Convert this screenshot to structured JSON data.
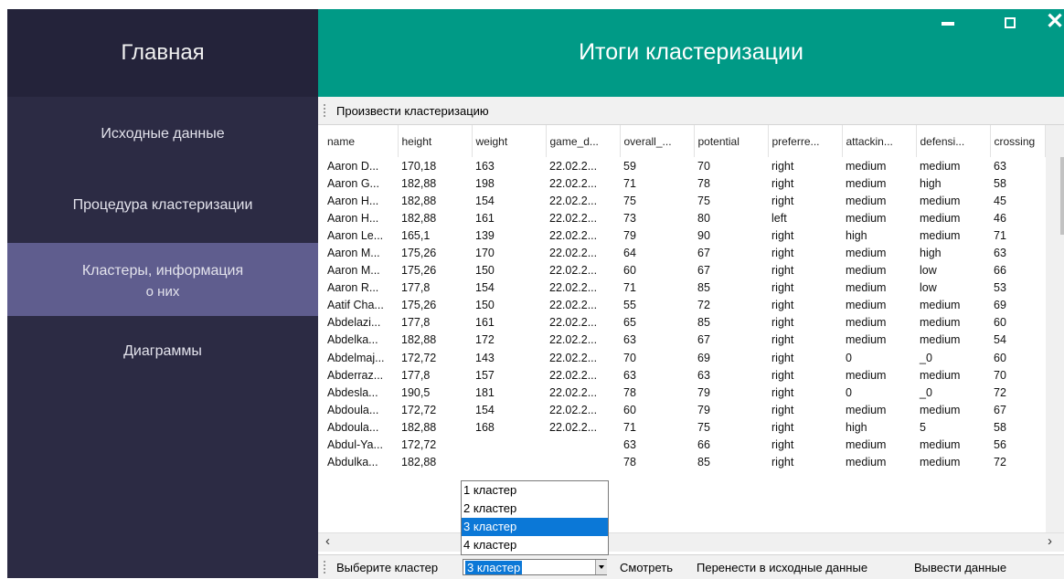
{
  "sidebar": {
    "title": "Главная",
    "items": [
      {
        "label": "Исходные данные"
      },
      {
        "label": "Процедура кластеризации"
      },
      {
        "label_line1": "Кластеры, информация",
        "label_line2": "о них"
      },
      {
        "label": "Диаграммы"
      }
    ],
    "active_index": 2
  },
  "header": {
    "title": "Итоги кластеризации",
    "minimize_icon": "minimize-icon",
    "maximize_icon": "maximize-icon",
    "close_icon": "close-icon",
    "close_glyph": "✕"
  },
  "colors": {
    "sidebar_bg": "#2c2b44",
    "brand_bg": "#24233a",
    "active_bg": "#5f5d8e",
    "header_bg": "#009a86",
    "selection": "#0b78d7"
  },
  "toolbar": {
    "run_label": "Произвести кластеризацию"
  },
  "table": {
    "columns": [
      "name",
      "height",
      "weight",
      "game_d...",
      "overall_...",
      "potential",
      "preferre...",
      "attackin...",
      "defensi...",
      "crossing"
    ],
    "rows": [
      [
        "Aaron D...",
        "170,18",
        "163",
        "22.02.2...",
        "59",
        "70",
        "right",
        "medium",
        "medium",
        "63"
      ],
      [
        "Aaron G...",
        "182,88",
        "198",
        "22.02.2...",
        "71",
        "78",
        "right",
        "medium",
        "high",
        "58"
      ],
      [
        "Aaron H...",
        "182,88",
        "154",
        "22.02.2...",
        "75",
        "75",
        "right",
        "medium",
        "medium",
        "45"
      ],
      [
        "Aaron H...",
        "182,88",
        "161",
        "22.02.2...",
        "73",
        "80",
        "left",
        "medium",
        "medium",
        "46"
      ],
      [
        "Aaron Le...",
        "165,1",
        "139",
        "22.02.2...",
        "79",
        "90",
        "right",
        "high",
        "medium",
        "71"
      ],
      [
        "Aaron M...",
        "175,26",
        "170",
        "22.02.2...",
        "64",
        "67",
        "right",
        "medium",
        "high",
        "63"
      ],
      [
        "Aaron M...",
        "175,26",
        "150",
        "22.02.2...",
        "60",
        "67",
        "right",
        "medium",
        "low",
        "66"
      ],
      [
        "Aaron R...",
        "177,8",
        "154",
        "22.02.2...",
        "71",
        "85",
        "right",
        "medium",
        "low",
        "53"
      ],
      [
        "Aatif Cha...",
        "175,26",
        "150",
        "22.02.2...",
        "55",
        "72",
        "right",
        "medium",
        "medium",
        "69"
      ],
      [
        "Abdelazi...",
        "177,8",
        "161",
        "22.02.2...",
        "65",
        "85",
        "right",
        "medium",
        "medium",
        "60"
      ],
      [
        "Abdelka...",
        "182,88",
        "172",
        "22.02.2...",
        "63",
        "67",
        "right",
        "medium",
        "medium",
        "54"
      ],
      [
        "Abdelmaj...",
        "172,72",
        "143",
        "22.02.2...",
        "70",
        "69",
        "right",
        "0",
        "_0",
        "60"
      ],
      [
        "Abderraz...",
        "177,8",
        "157",
        "22.02.2...",
        "63",
        "63",
        "right",
        "medium",
        "medium",
        "70"
      ],
      [
        "Abdesla...",
        "190,5",
        "181",
        "22.02.2...",
        "78",
        "79",
        "right",
        "0",
        "_0",
        "72"
      ],
      [
        "Abdoula...",
        "172,72",
        "154",
        "22.02.2...",
        "60",
        "79",
        "right",
        "medium",
        "medium",
        "67"
      ],
      [
        "Abdoula...",
        "182,88",
        "168",
        "22.02.2...",
        "71",
        "75",
        "right",
        "high",
        "5",
        "58"
      ],
      [
        "Abdul-Ya...",
        "172,72",
        "",
        "",
        "63",
        "66",
        "right",
        "medium",
        "medium",
        "56"
      ],
      [
        "Abdulka...",
        "182,88",
        "",
        "",
        "78",
        "85",
        "right",
        "medium",
        "medium",
        "72"
      ]
    ]
  },
  "scroll": {
    "left_glyph": "‹",
    "right_glyph": "›"
  },
  "bottom": {
    "choose_label": "Выберите кластер",
    "selected": "3 кластер",
    "options": [
      "1 кластер",
      "2 кластер",
      "3 кластер",
      "4 кластер"
    ],
    "selected_index": 2,
    "view_label": "Смотреть",
    "transfer_label": "Перенести в исходные данные",
    "output_label": "Вывести данные"
  }
}
